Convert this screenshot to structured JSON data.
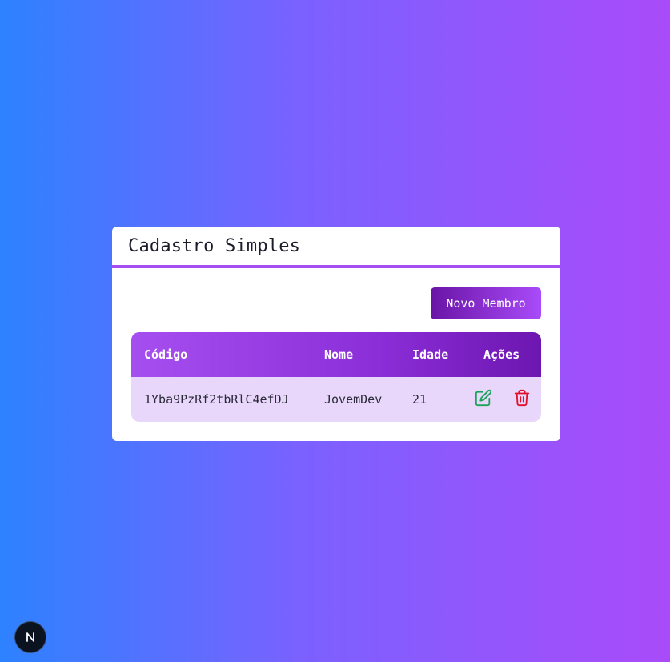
{
  "card": {
    "title": "Cadastro Simples",
    "new_button_label": "Novo Membro"
  },
  "table": {
    "headers": [
      "Código",
      "Nome",
      "Idade",
      "Ações"
    ],
    "rows": [
      {
        "codigo": "1Yba9PzRf2tbRlC4efDJ",
        "nome": "JovemDev",
        "idade": "21",
        "actions": [
          "edit-icon",
          "trash-icon"
        ]
      }
    ]
  },
  "colors": {
    "background_start": "#2d82ff",
    "background_end": "#a94bf9",
    "accent": "#a64ff0",
    "edit_icon": "#1aa35a",
    "delete_icon": "#e0102a",
    "row_background": "#e9d7fb"
  },
  "badge": {
    "letter": "N",
    "icon": "nextjs-logo-icon"
  }
}
